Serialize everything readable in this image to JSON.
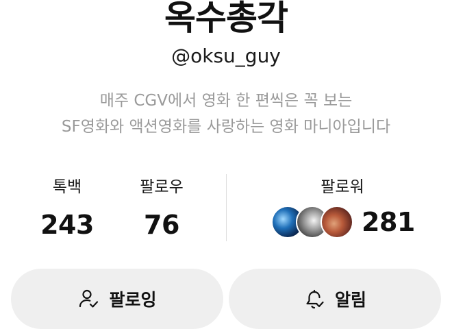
{
  "profile": {
    "name": "옥수총각",
    "handle": "@oksu_guy",
    "bio_lines": [
      "매주 CGV에서 영화 한 편씩은 꼭 보는",
      "SF영화와 액션영화를 사랑하는 영화 마니아입니다"
    ]
  },
  "stats": {
    "posts": {
      "label": "톡백",
      "value": "243"
    },
    "following": {
      "label": "팔로우",
      "value": "76"
    },
    "followers": {
      "label": "팔로워",
      "value": "281",
      "avatar_count": 3
    }
  },
  "actions": {
    "follow": {
      "label": "팔로잉",
      "icon": "user-check-icon"
    },
    "alarm": {
      "label": "알림",
      "icon": "bell-check-icon"
    }
  }
}
